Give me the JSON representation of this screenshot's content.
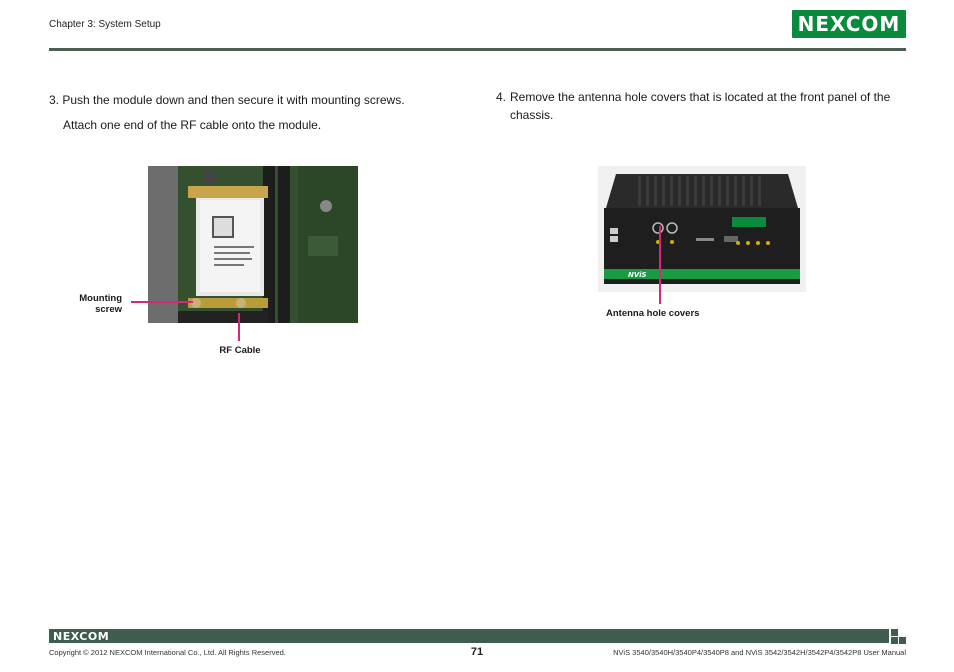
{
  "header": {
    "chapter": "Chapter 3: System Setup",
    "logo_text": "NEXCOM"
  },
  "steps": {
    "step3_line1": "3. Push the module down and then secure it with mounting screws.",
    "step3_line2": "Attach one end of the RF cable onto the module.",
    "step4_number": "4.",
    "step4_text": "Remove the antenna hole covers that is located at the front panel of the chassis."
  },
  "figure1": {
    "callout_mounting": "Mounting screw",
    "callout_rf": "RF Cable"
  },
  "figure2": {
    "callout_antenna": "Antenna hole covers",
    "device_label": "NViS"
  },
  "footer": {
    "logo_text": "NEXCOM",
    "copyright": "Copyright © 2012 NEXCOM International Co., Ltd. All Rights Reserved.",
    "page_number": "71",
    "manual_title": "NViS 3540/3540H/3540P4/3540P8 and NViS 3542/3542H/3542P4/3542P8 User Manual"
  },
  "colors": {
    "brand_green": "#0a8a3c",
    "rule_green": "#4a5e52",
    "callout_pink": "#d6287a"
  }
}
